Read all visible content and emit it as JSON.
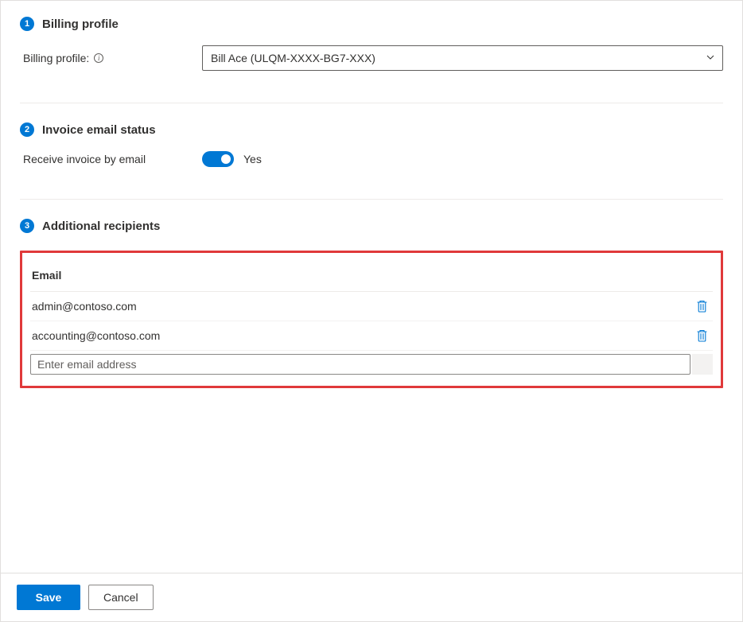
{
  "section1": {
    "step": "1",
    "title": "Billing profile",
    "label": "Billing profile:",
    "selected": "Bill Ace (ULQM-XXXX-BG7-XXX)"
  },
  "section2": {
    "step": "2",
    "title": "Invoice email status",
    "label": "Receive invoice by email",
    "toggle_value": "Yes"
  },
  "section3": {
    "step": "3",
    "title": "Additional recipients",
    "column_header": "Email",
    "recipients": [
      "admin@contoso.com",
      "accounting@contoso.com"
    ],
    "input_placeholder": "Enter email address"
  },
  "footer": {
    "save": "Save",
    "cancel": "Cancel"
  }
}
